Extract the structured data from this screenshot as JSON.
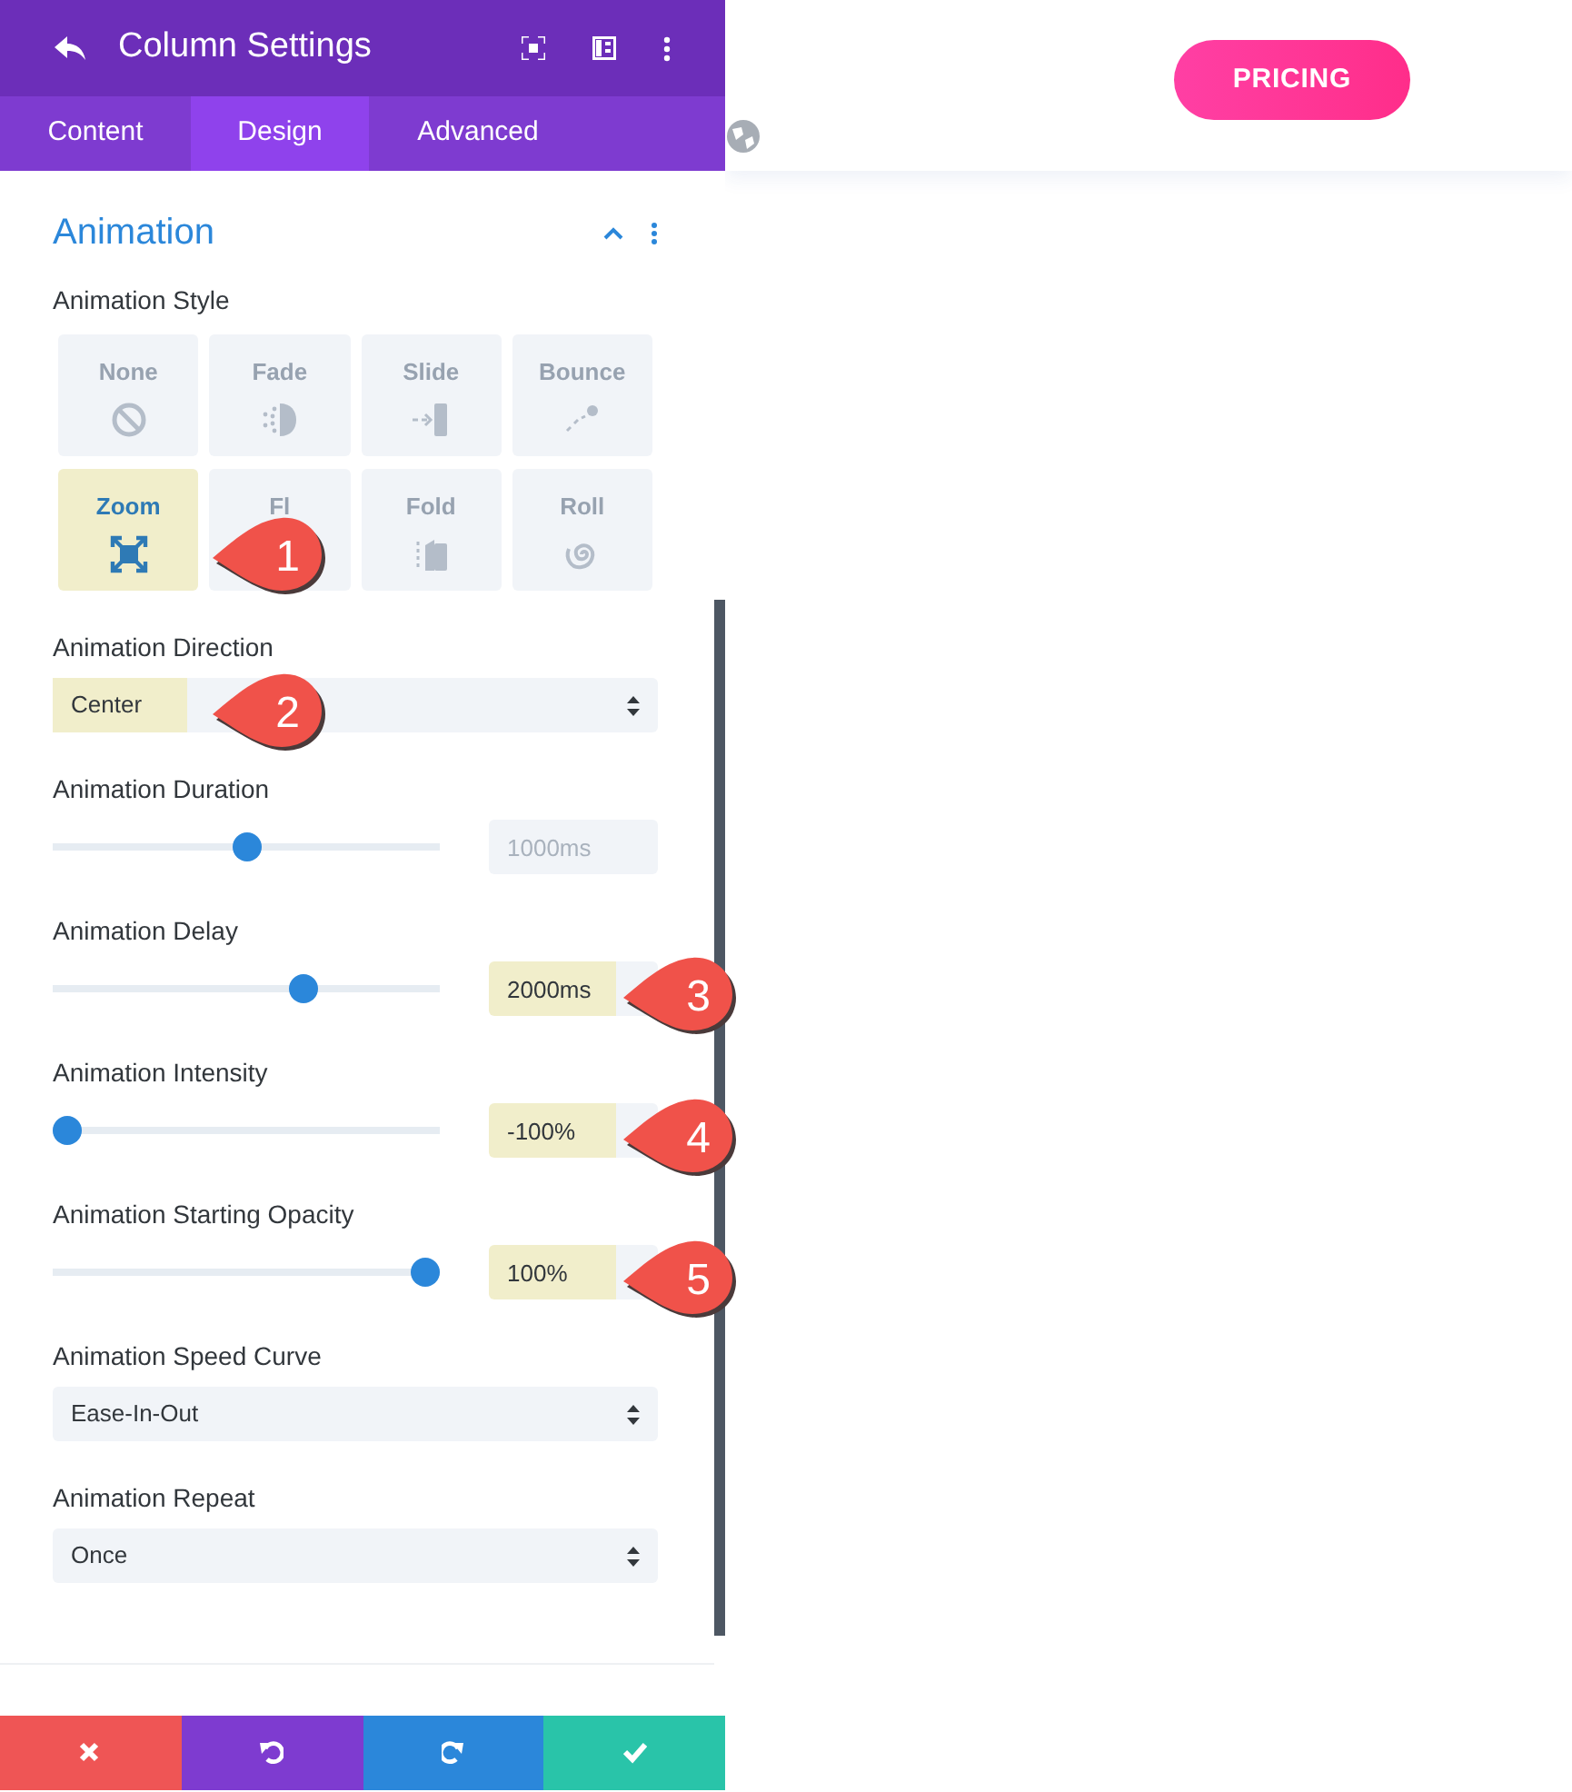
{
  "header": {
    "title": "Column Settings"
  },
  "tabs": [
    {
      "label": "Content",
      "selected": false
    },
    {
      "label": "Design",
      "selected": true
    },
    {
      "label": "Advanced",
      "selected": false
    }
  ],
  "section": {
    "title": "Animation",
    "expanded": true
  },
  "settings": [
    {
      "kind": "tiles",
      "label": "Animation Style",
      "tiles": [
        {
          "label": "None",
          "selected": false
        },
        {
          "label": "Fade",
          "selected": false
        },
        {
          "label": "Slide",
          "selected": false
        },
        {
          "label": "Bounce",
          "selected": false
        },
        {
          "label": "Zoom",
          "selected": true
        },
        {
          "label": "Fl",
          "selected": false
        },
        {
          "label": "Fold",
          "selected": false
        },
        {
          "label": "Roll",
          "selected": false
        }
      ],
      "callout": "1"
    },
    {
      "kind": "select",
      "label": "Animation Direction",
      "value": "Center",
      "highlighted": true,
      "callout": "2"
    },
    {
      "kind": "slider",
      "label": "Animation Duration",
      "level": 0.5,
      "placeholder": "1000ms",
      "highlighted": false
    },
    {
      "kind": "slider",
      "label": "Animation Delay",
      "level": 0.66,
      "value": "2000ms",
      "highlighted": true,
      "callout": "3"
    },
    {
      "kind": "slider",
      "label": "Animation Intensity",
      "level": 0,
      "value": "-100%",
      "highlighted": true,
      "callout": "4"
    },
    {
      "kind": "slider",
      "label": "Animation Starting Opacity",
      "level": 1,
      "value": "100%",
      "highlighted": true,
      "callout": "5"
    },
    {
      "kind": "select",
      "label": "Animation Speed Curve",
      "value": "Ease-In-Out",
      "highlighted": false
    },
    {
      "kind": "select",
      "label": "Animation Repeat",
      "value": "Once",
      "highlighted": false
    }
  ],
  "footer": [
    {
      "kind": "discard"
    },
    {
      "kind": "undo"
    },
    {
      "kind": "redo"
    },
    {
      "kind": "save"
    }
  ],
  "page": {
    "button": "PRICING"
  }
}
